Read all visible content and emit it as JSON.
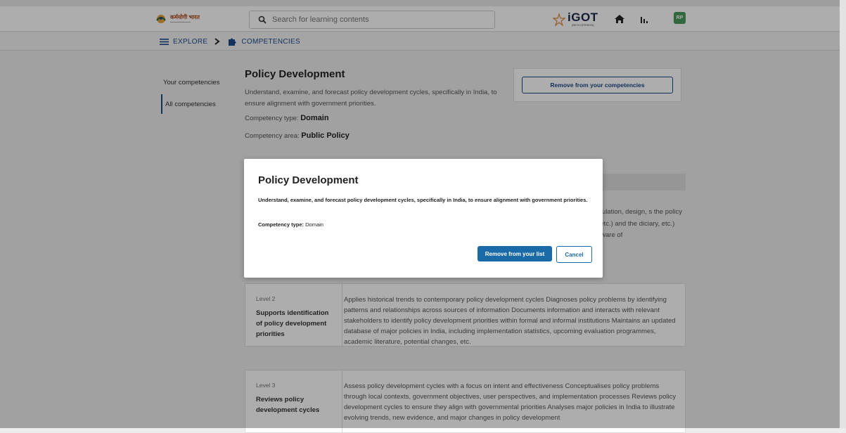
{
  "header": {
    "logo_text": "कर्मयोगी भारत",
    "search_placeholder": "Search for learning contents",
    "brand": "iGOT",
    "brand_sub": "(BETA VERSION)",
    "avatar_initials": "RP",
    "icons": [
      "search-icon",
      "home-icon",
      "bar-chart-icon"
    ]
  },
  "breadcrumb": {
    "items": [
      "EXPLORE",
      "COMPETENCIES"
    ],
    "icons": [
      "menu-icon",
      "chevron-right-icon",
      "puzzle-icon"
    ]
  },
  "sidenav": {
    "items": [
      {
        "label": "Your competencies",
        "active": false
      },
      {
        "label": "All competencies",
        "active": true
      }
    ]
  },
  "competency": {
    "title": "Policy Development",
    "description": "Understand, examine, and forecast policy development cycles, specifically in India, to ensure alignment with government priorities.",
    "type_label": "Competency type:",
    "type_value": "Domain",
    "area_label": "Competency area:",
    "area_value": "Public Policy",
    "remove_button": "Remove from your competencies"
  },
  "behind_text": "mulation, design, s the policy , etc.) and the diciary, etc.) Aware of",
  "levels": [
    {
      "level": "Level 2",
      "name": "Supports identification of policy development priorities",
      "description": "Applies historical trends to contemporary policy development cycles Diagnoses policy problems by identifying patterns and relationships across sources of information Documents information and interacts with relevant stakeholders to identify policy development priorities within formal and informal institutions Maintains an updated database of major policies in India, including implementation statistics, upcoming evaluation programmes, academic literature, potential changes, etc."
    },
    {
      "level": "Level 3",
      "name": "Reviews policy development cycles",
      "description": "Assess policy development cycles with a focus on intent and effectiveness Conceptualises policy problems through local contexts, government objectives, user perspectives, and implementation processes Reviews policy development cycles to ensure they align with governmental priorities Analyses major policies in India to illustrate evolving trends, new evidence, and major changes in policy development"
    }
  ],
  "modal": {
    "title": "Policy Development",
    "description": "Understand, examine, and forecast policy development cycles, specifically in India, to ensure alignment with government priorities.",
    "type_label": "Competency type:",
    "type_value": "Domain",
    "confirm_button": "Remove from your list",
    "cancel_button": "Cancel"
  },
  "colors": {
    "primary": "#1a6aa8",
    "navy": "#1b4a8a",
    "avatar_bg": "#4a9a5a"
  }
}
